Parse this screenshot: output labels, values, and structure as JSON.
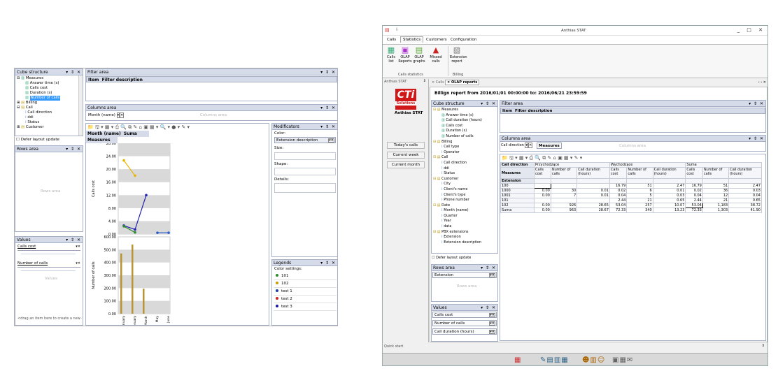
{
  "left": {
    "cube_title": "Cube structure",
    "tree": [
      "Measures",
      "Answer time (s)",
      "Calls cost",
      "Duration (s)",
      "Number of calls",
      "Billing",
      "Call",
      "Call direction",
      "ddi",
      "Status",
      "Customer"
    ],
    "defer": "Defer layout update",
    "rows_title": "Rows area",
    "rows_wm": "Rows area",
    "values_title": "Values",
    "values": [
      "Calls cost",
      "Number of calls"
    ],
    "values_wm": "Values",
    "drag_hint": "<drag an item here to create a new g",
    "filter_title": "Filter area",
    "filter_cols": [
      "Item",
      "Filter description"
    ],
    "columns_title": "Columns area",
    "columns_wm": "Columns area",
    "col_field": "Month (name)",
    "pivot_header": [
      "Month (name)",
      "Suma"
    ],
    "measures": "Measures",
    "mod_title": "Modificators",
    "mod_color": "Color:",
    "mod_select": "Extension description",
    "mod_size": "Size:",
    "mod_shape": "Shape:",
    "mod_details": "Details:",
    "leg_title": "Legends",
    "leg_settings": "Color settings:",
    "legends": [
      {
        "name": "101",
        "color": "#2e8b2e"
      },
      {
        "name": "102",
        "color": "#c8a000"
      },
      {
        "name": "test 1",
        "color": "#1f3f9f"
      },
      {
        "name": "test 2",
        "color": "#d02020"
      },
      {
        "name": "test 3",
        "color": "#1a1aa8"
      }
    ],
    "xaxis_label": "Month (name)"
  },
  "chart_data": [
    {
      "type": "line",
      "ylabel": "Calls cost",
      "ylim": [
        0,
        28
      ],
      "yticks": [
        "0.00",
        "4.00",
        "8.00",
        "12.00",
        "16.00",
        "20.00",
        "24.00",
        "28.00"
      ],
      "categories": [
        "January",
        "February",
        "March",
        "May",
        "June"
      ],
      "series": [
        {
          "name": "102",
          "color": "#e8b400",
          "values": [
            22.7,
            18,
            null,
            null,
            null
          ]
        },
        {
          "name": "test 3",
          "color": "#2020b0",
          "values": [
            2.6,
            1.4,
            12,
            null,
            null
          ]
        },
        {
          "name": "101",
          "color": "#2e8b2e",
          "values": [
            2.4,
            0.5,
            null,
            null,
            null
          ]
        },
        {
          "name": "test 1",
          "color": "#2a5cc8",
          "values": [
            null,
            null,
            null,
            0.4,
            0.4
          ]
        }
      ]
    },
    {
      "type": "bar",
      "ylabel": "Number of calls",
      "ylim": [
        0,
        600
      ],
      "yticks": [
        "0.00",
        "100.00",
        "200.00",
        "300.00",
        "400.00",
        "500.00",
        "600.00"
      ],
      "categories": [
        "January",
        "February",
        "March",
        "May",
        "June"
      ],
      "values": [
        470,
        540,
        195,
        0,
        0
      ],
      "color": "#b8952e"
    }
  ],
  "right": {
    "title": "Anthias STAT",
    "tabs": [
      "Calls",
      "Statistics",
      "Customers",
      "Configuration"
    ],
    "ribbon": [
      {
        "label": "Calls\nlist",
        "icon": "▦"
      },
      {
        "label": "OLAP\nReports",
        "icon": "▣"
      },
      {
        "label": "OLAP\ngraphs",
        "icon": "▤"
      },
      {
        "label": "Missed\ncalls",
        "icon": "▲"
      },
      {
        "label": "Extension\nreport",
        "icon": "▧"
      }
    ],
    "grp1": "Calls statistics",
    "grp2": "Billing",
    "side_title": "Anthias STAT",
    "logo_text": "CTi",
    "logo_sub": "Solutions",
    "logo_app": "Anthias STAT",
    "buttons": [
      "Today's calls",
      "Current week",
      "Current month"
    ],
    "doc_tabs": [
      "Calls",
      "OLAP reports"
    ],
    "report_title": "Billign report from 2016/01/01 00:00:00 to: 2016/06/21 23:59:59",
    "cube_title": "Cube structure",
    "tree": [
      "Measures",
      "Answer time (s)",
      "Call duration (hours)",
      "Calls cost",
      "Duration (s)",
      "Number of calls",
      "Billing",
      "Call type",
      "Operator",
      "Call",
      "Call direction",
      "ddi",
      "Status",
      "Customer",
      "City",
      "Client's name",
      "Client's type",
      "Phone number",
      "Date",
      "Month (name)",
      "Quarter",
      "Year",
      "data",
      "PBX extensions",
      "Extension",
      "Extension description"
    ],
    "defer": "Defer layout update",
    "rows_title": "Rows area",
    "rows_field": "Extension",
    "rows_wm": "Rows area",
    "values_title": "Values",
    "values": [
      "Calls cost",
      "Number of calls",
      "Call duration (hours)"
    ],
    "filter_title": "Filter area",
    "filter_cols": [
      "Item",
      "Filter description"
    ],
    "columns_title": "Columns area",
    "col_field": "Call direction",
    "col_measures": "Measures",
    "columns_wm": "Columns area",
    "grid_top": [
      "Call direction",
      "Przychodzące",
      "Wychodzące",
      "Suma"
    ],
    "grid_measures": "Measures",
    "grid_ext": "Extension",
    "grid_sub": [
      "Calls cost",
      "Number of calls",
      "Call duration (hours)",
      "Calls cost",
      "Number of calls",
      "Call duration (hours)",
      "Calls cost",
      "Number of calls",
      "Call duration (hours)"
    ],
    "grid_rows": [
      [
        "100",
        "",
        "",
        "",
        "16.79",
        "51",
        "2.47",
        "16.79",
        "51",
        "2.47"
      ],
      [
        "1000",
        "0.00",
        "30",
        "0.01",
        "0.02",
        "6",
        "0.01",
        "0.02",
        "36",
        "0.03"
      ],
      [
        "1001",
        "0.00",
        "7",
        "0.01",
        "0.04",
        "5",
        "0.03",
        "0.04",
        "12",
        "0.04"
      ],
      [
        "101",
        "",
        "",
        "",
        "2.44",
        "21",
        "0.65",
        "2.44",
        "21",
        "0.65"
      ],
      [
        "102",
        "0.00",
        "926",
        "28.65",
        "53.04",
        "257",
        "10.07",
        "53.04",
        "1,183",
        "38.72"
      ],
      [
        "Suma",
        "0.00",
        "963",
        "28.67",
        "72.33",
        "340",
        "13.23",
        "72.33",
        "1,303",
        "41.90"
      ]
    ],
    "quick_start": "Quick start"
  }
}
